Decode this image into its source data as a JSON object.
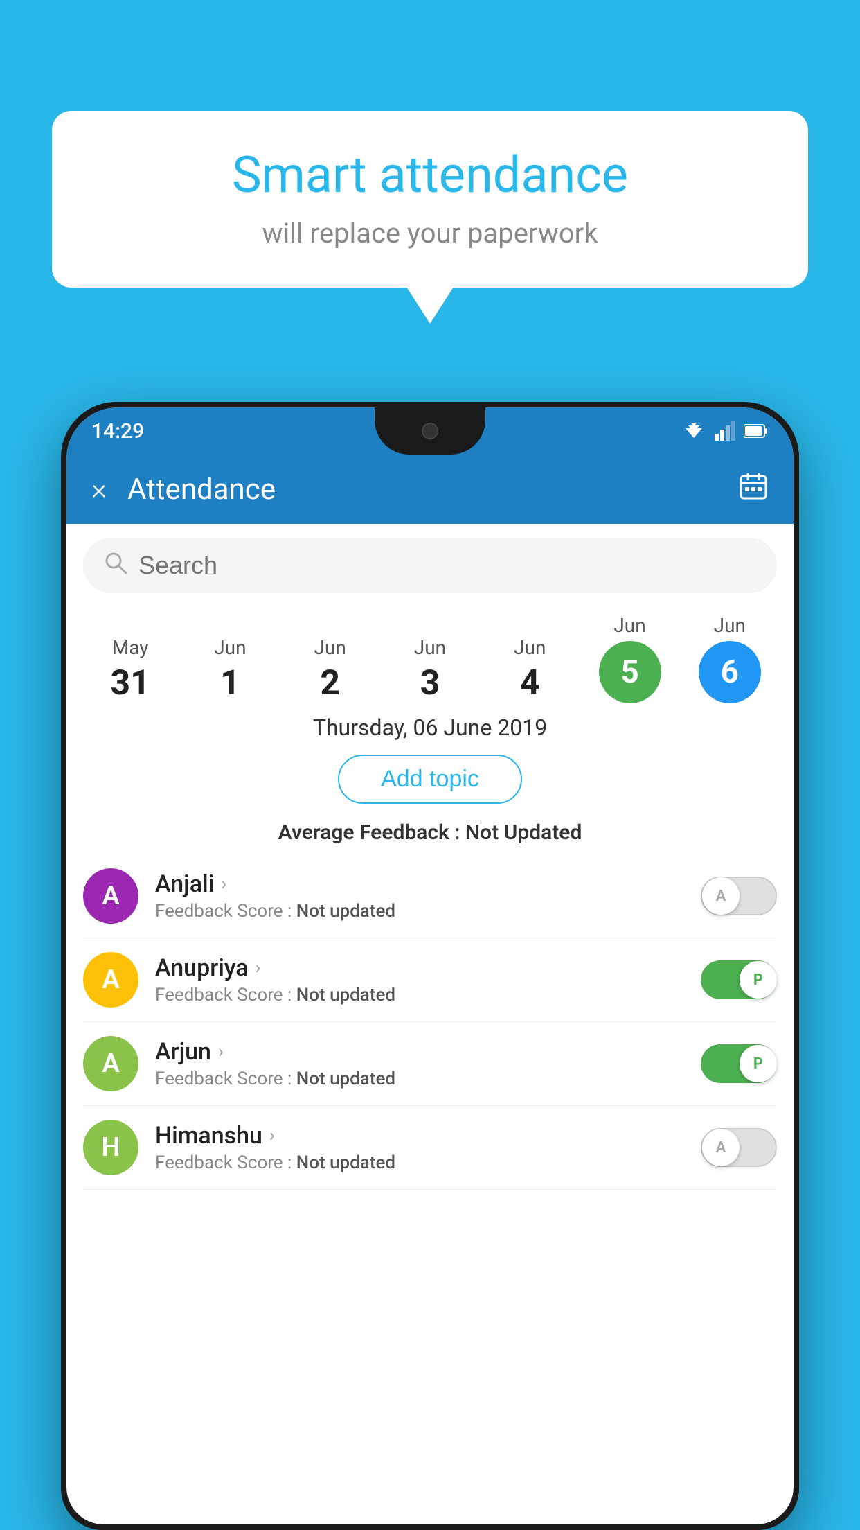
{
  "background_color": "#29b6e8",
  "speech_bubble": {
    "title": "Smart attendance",
    "subtitle": "will replace your paperwork"
  },
  "status_bar": {
    "time": "14:29"
  },
  "app_bar": {
    "title": "Attendance",
    "close_label": "×",
    "calendar_icon": "📅"
  },
  "search": {
    "placeholder": "Search"
  },
  "calendar": {
    "days": [
      {
        "month": "May",
        "num": "31",
        "selected": ""
      },
      {
        "month": "Jun",
        "num": "1",
        "selected": ""
      },
      {
        "month": "Jun",
        "num": "2",
        "selected": ""
      },
      {
        "month": "Jun",
        "num": "3",
        "selected": ""
      },
      {
        "month": "Jun",
        "num": "4",
        "selected": ""
      },
      {
        "month": "Jun",
        "num": "5",
        "selected": "green"
      },
      {
        "month": "Jun",
        "num": "6",
        "selected": "blue"
      }
    ]
  },
  "selected_date": "Thursday, 06 June 2019",
  "add_topic_label": "Add topic",
  "avg_feedback_label": "Average Feedback :",
  "avg_feedback_value": "Not Updated",
  "students": [
    {
      "name": "Anjali",
      "initial": "A",
      "color": "#9c27b0",
      "feedback_label": "Feedback Score :",
      "feedback_value": "Not updated",
      "toggle": "off",
      "toggle_letter": "A"
    },
    {
      "name": "Anupriya",
      "initial": "A",
      "color": "#ffc107",
      "feedback_label": "Feedback Score :",
      "feedback_value": "Not updated",
      "toggle": "on",
      "toggle_letter": "P"
    },
    {
      "name": "Arjun",
      "initial": "A",
      "color": "#8bc34a",
      "feedback_label": "Feedback Score :",
      "feedback_value": "Not updated",
      "toggle": "on",
      "toggle_letter": "P"
    },
    {
      "name": "Himanshu",
      "initial": "H",
      "color": "#8bc34a",
      "feedback_label": "Feedback Score :",
      "feedback_value": "Not updated",
      "toggle": "off",
      "toggle_letter": "A"
    }
  ]
}
